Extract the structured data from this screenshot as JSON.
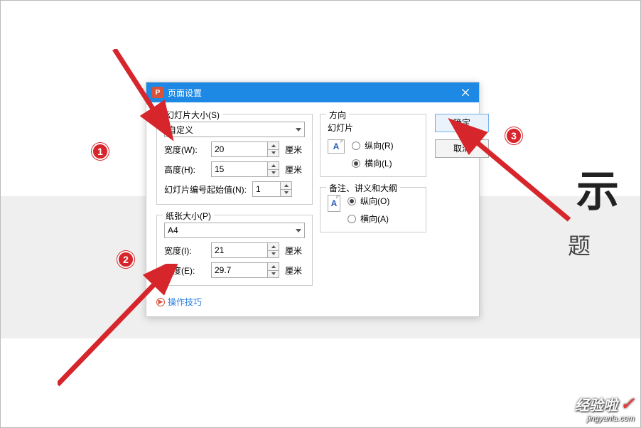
{
  "dialog": {
    "title": "页面设置",
    "group_slide_size": {
      "title": "幻灯片大小(S)",
      "preset": "自定义",
      "width_label": "宽度(W):",
      "width_value": "20",
      "height_label": "高度(H):",
      "height_value": "15",
      "unit": "厘米",
      "start_num_label": "幻灯片编号起始值(N):",
      "start_num_value": "1"
    },
    "group_paper_size": {
      "title": "纸张大小(P)",
      "preset": "A4",
      "width_label": "宽度(I):",
      "width_value": "21",
      "height_label": "高度(E):",
      "height_value": "29.7",
      "unit": "厘米"
    },
    "orientation": {
      "title": "方向",
      "slide": {
        "title": "幻灯片",
        "portrait": "纵向(R)",
        "landscape": "横向(L)"
      },
      "notes": {
        "title": "备注、讲义和大纲",
        "portrait": "纵向(O)",
        "landscape": "横向(A)"
      },
      "icon_letter": "A"
    },
    "buttons": {
      "ok": "确定",
      "cancel": "取消"
    },
    "tip_link": "操作技巧"
  },
  "background": {
    "big_text_fragment": "示",
    "sub_text_fragment": "题"
  },
  "annotations": {
    "n1": "1",
    "n2": "2",
    "n3": "3"
  },
  "watermark": {
    "line1": "经验啦",
    "line2": "jingyanla.com",
    "check": "✓"
  }
}
